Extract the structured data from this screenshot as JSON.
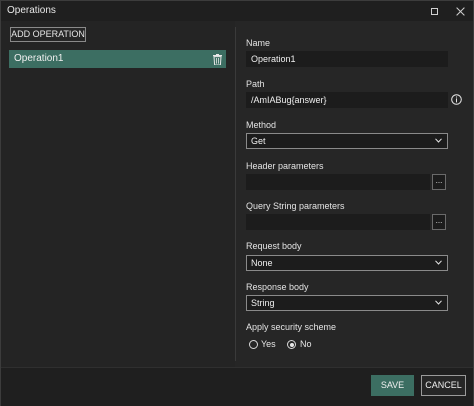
{
  "window": {
    "title": "Operations"
  },
  "left_panel": {
    "add_button_label": "ADD OPERATION",
    "operations": [
      {
        "label": "Operation1",
        "selected": true
      }
    ]
  },
  "form": {
    "name": {
      "label": "Name",
      "value": "Operation1"
    },
    "path": {
      "label": "Path",
      "value": "/AmIABug{answer}"
    },
    "method": {
      "label": "Method",
      "value": "Get"
    },
    "header_parameters": {
      "label": "Header parameters",
      "value": "",
      "browse_label": "..."
    },
    "query_string_parameters": {
      "label": "Query String parameters",
      "value": "",
      "browse_label": "..."
    },
    "request_body": {
      "label": "Request body",
      "value": "None"
    },
    "response_body": {
      "label": "Response body",
      "value": "String"
    },
    "security_scheme": {
      "label": "Apply security scheme",
      "options": [
        {
          "label": "Yes",
          "selected": false
        },
        {
          "label": "No",
          "selected": true
        }
      ]
    }
  },
  "footer": {
    "save_label": "SAVE",
    "cancel_label": "CANCEL"
  },
  "colors": {
    "accent": "#3c6e62",
    "background": "#262626",
    "input_background": "#1c1c1c"
  },
  "icons": [
    "maximize-icon",
    "close-icon",
    "trash-icon",
    "info-icon",
    "chevron-down-icon"
  ]
}
